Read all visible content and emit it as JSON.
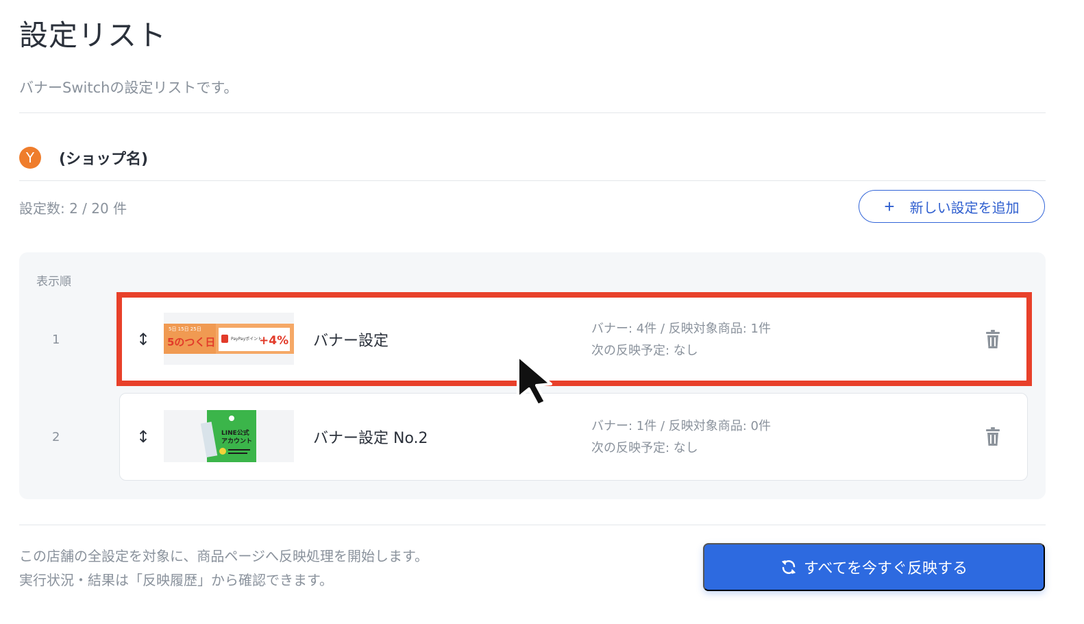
{
  "page": {
    "title": "設定リスト",
    "description": "バナーSwitchの設定リストです。"
  },
  "shop": {
    "logo_letter": "Y",
    "logo_color": "#ef7d2c",
    "name": "(ショップ名)"
  },
  "summary": {
    "count_text": "設定数: 2 / 20 件",
    "add_button_label": "新しい設定を追加",
    "add_button_icon": "plus-icon"
  },
  "list": {
    "order_header": "表示順",
    "items": [
      {
        "order": "1",
        "name": "バナー設定",
        "meta_line1": "バナー: 4件 / 反映対象商品: 1件",
        "meta_line2": "次の反映予定: なし",
        "thumb_big": "5のつく日",
        "thumb_dates": "5日 15日 25日",
        "thumb_small": "PayPayポイント",
        "thumb_plus": "+4%",
        "highlighted": true
      },
      {
        "order": "2",
        "name": "バナー設定 No.2",
        "meta_line1": "バナー: 1件 / 反映対象商品: 0件",
        "meta_line2": "次の反映予定: なし",
        "thumb_line1": "LINE公式",
        "thumb_line2": "アカウント",
        "highlighted": false
      }
    ]
  },
  "footer": {
    "line1": "この店舗の全設定を対象に、商品ページへ反映処理を開始します。",
    "line2": "実行状況・結果は「反映履歴」から確認できます。",
    "apply_button_label": "すべてを今すぐ反映する",
    "apply_button_icon": "refresh-icon"
  },
  "colors": {
    "accent": "#2d6ae0",
    "highlight": "#e8402a"
  }
}
